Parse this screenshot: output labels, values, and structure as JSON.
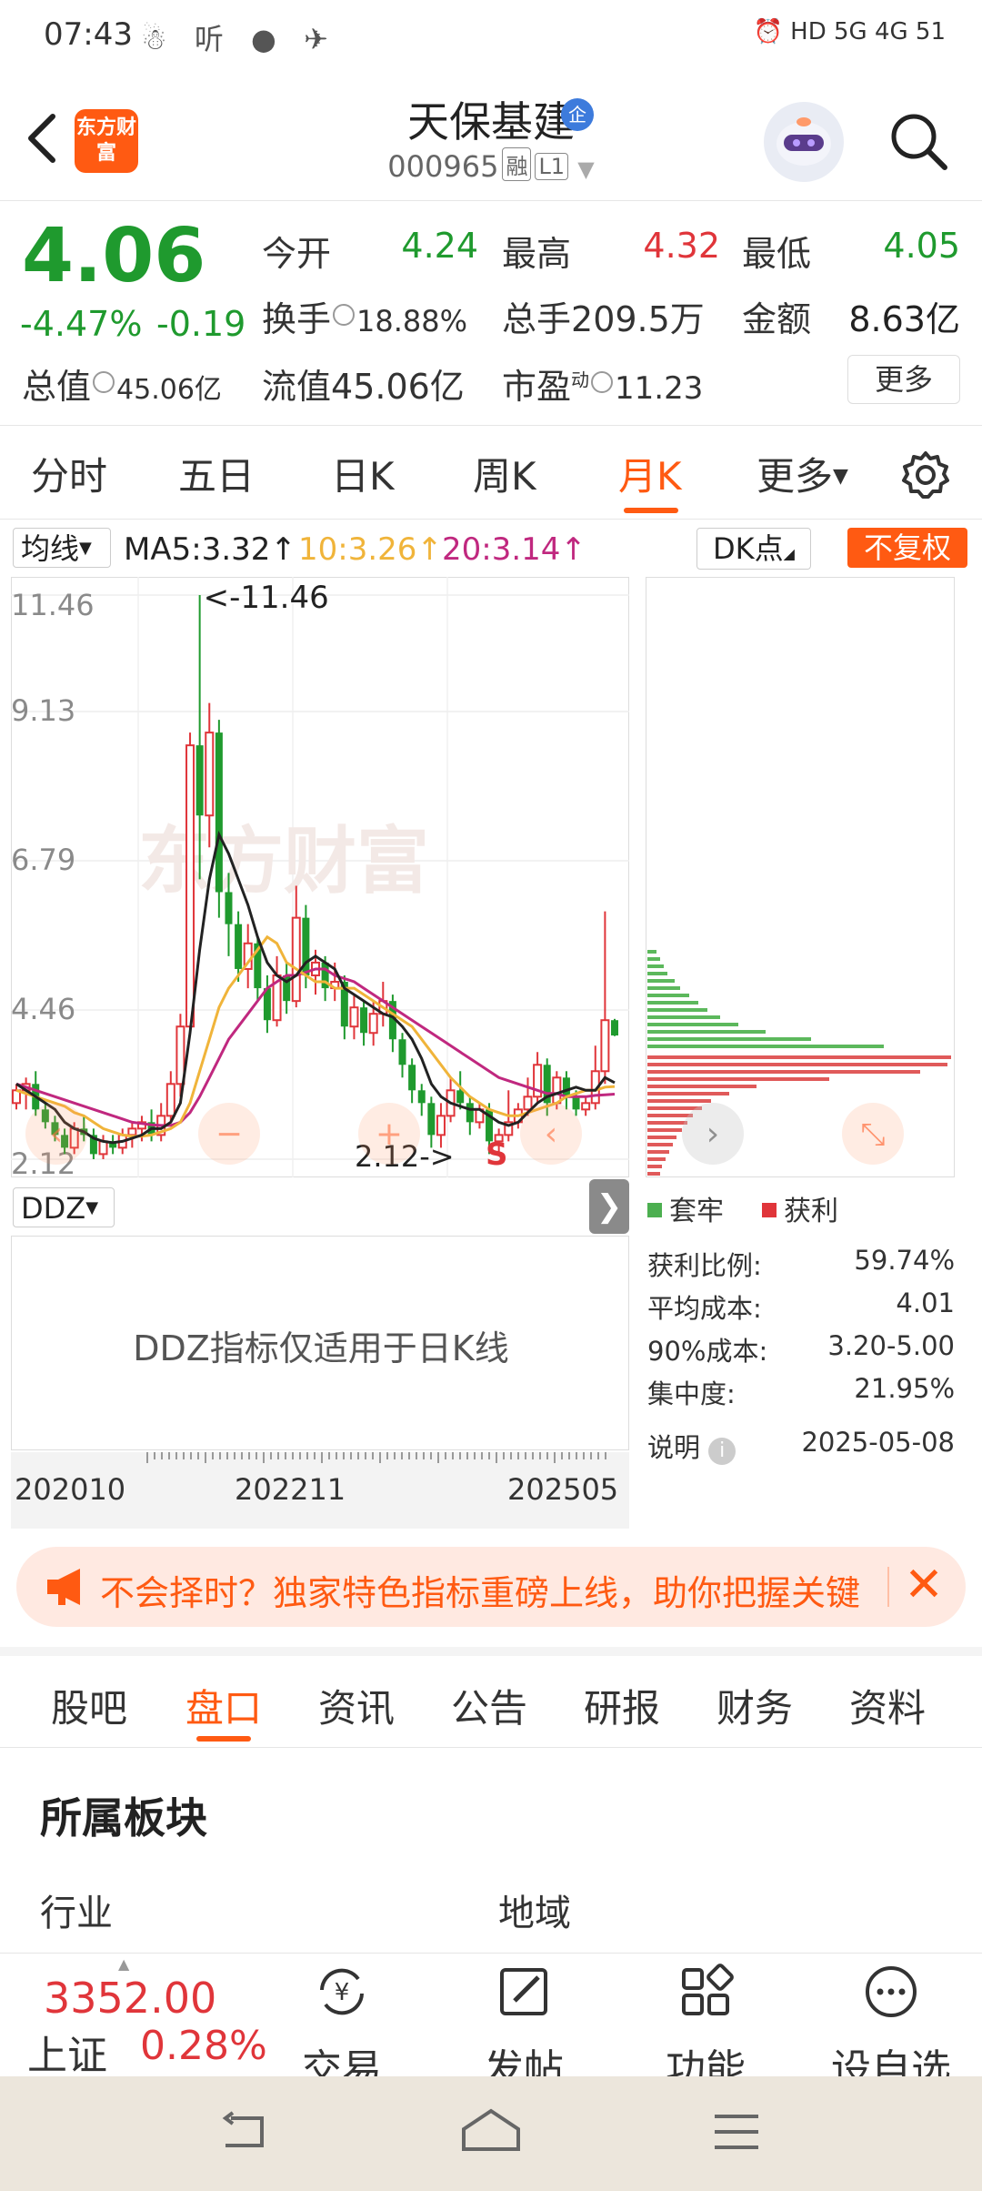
{
  "status": {
    "time": "07:43",
    "left_icons": "☃ 听 ● ✈",
    "right_icons": "⏰ HD 5G 4G 51"
  },
  "header": {
    "logo_text": "东方财富",
    "stock_name": "天保基建",
    "qi_badge": "企",
    "stock_code": "000965",
    "tag_rong": "融",
    "tag_level": "L1"
  },
  "quote": {
    "price": "4.06",
    "change_pct": "-4.47%",
    "change": "-0.19",
    "open_label": "今开",
    "open": "4.24",
    "high_label": "最高",
    "high": "4.32",
    "low_label": "最低",
    "low": "4.05",
    "turnover_label": "换手",
    "turnover": "18.88%",
    "volume_label": "总手",
    "volume": "209.5万",
    "amount_label": "金额",
    "amount": "8.63亿",
    "mcap_label": "总值",
    "mcap": "45.06亿",
    "float_label": "流值",
    "float": "45.06亿",
    "pe_label": "市盈",
    "pe_sup": "动",
    "pe": "11.23",
    "more": "更多"
  },
  "period_tabs": [
    "分时",
    "五日",
    "日K",
    "周K",
    "月K",
    "更多"
  ],
  "active_period": "月K",
  "ma": {
    "select": "均线",
    "ma5": "MA5:3.32↑",
    "ma10": "10:3.26↑",
    "ma20": "20:3.14↑",
    "dk": "DK点",
    "fuquan": "不复权"
  },
  "colors": {
    "accent": "#ff5a12",
    "up": "#e0353a",
    "down": "#1f9a2e",
    "ma5": "#222222",
    "ma10": "#f0b43a",
    "ma20": "#c0287f"
  },
  "chart_data": {
    "type": "candlestick",
    "y_ticks": [
      "11.46",
      "9.13",
      "6.79",
      "4.46",
      "2.12"
    ],
    "ylim": [
      2.12,
      11.46
    ],
    "max_annotation": "<-11.46",
    "min_annotation": "2.12->",
    "x_ticks": [
      "202010",
      "202211",
      "202505"
    ],
    "watermark": "东方财富",
    "markers": [
      "S"
    ],
    "candles": [
      [
        3.0,
        3.2,
        2.9,
        3.3
      ],
      [
        3.2,
        3.3,
        2.9,
        3.4
      ],
      [
        3.3,
        2.9,
        2.8,
        3.5
      ],
      [
        2.9,
        2.7,
        2.6,
        3.0
      ],
      [
        2.7,
        2.5,
        2.4,
        2.8
      ],
      [
        2.5,
        2.3,
        2.2,
        2.6
      ],
      [
        2.3,
        2.6,
        2.2,
        2.7
      ],
      [
        2.6,
        2.5,
        2.4,
        2.8
      ],
      [
        2.5,
        2.2,
        2.1,
        2.6
      ],
      [
        2.2,
        2.4,
        2.1,
        2.5
      ],
      [
        2.4,
        2.3,
        2.2,
        2.5
      ],
      [
        2.3,
        2.5,
        2.2,
        2.6
      ],
      [
        2.5,
        2.6,
        2.3,
        2.7
      ],
      [
        2.6,
        2.7,
        2.4,
        2.8
      ],
      [
        2.7,
        2.5,
        2.4,
        2.9
      ],
      [
        2.5,
        2.8,
        2.4,
        3.0
      ],
      [
        2.8,
        3.3,
        2.7,
        3.5
      ],
      [
        3.3,
        4.2,
        3.1,
        4.4
      ],
      [
        4.2,
        8.6,
        4.1,
        8.8
      ],
      [
        8.6,
        7.5,
        6.5,
        11.46
      ],
      [
        7.5,
        8.8,
        7.0,
        9.3
      ],
      [
        8.8,
        6.3,
        5.9,
        9.0
      ],
      [
        6.3,
        5.8,
        5.3,
        6.6
      ],
      [
        5.8,
        5.1,
        4.9,
        6.0
      ],
      [
        5.1,
        5.5,
        4.8,
        5.8
      ],
      [
        5.5,
        4.8,
        4.6,
        5.6
      ],
      [
        4.8,
        4.3,
        4.1,
        5.0
      ],
      [
        4.3,
        5.0,
        4.2,
        5.3
      ],
      [
        5.0,
        4.6,
        4.4,
        5.2
      ],
      [
        4.6,
        5.9,
        4.5,
        6.4
      ],
      [
        5.9,
        5.0,
        4.8,
        6.1
      ],
      [
        5.0,
        5.2,
        4.7,
        5.4
      ],
      [
        5.2,
        4.8,
        4.6,
        5.3
      ],
      [
        4.8,
        4.9,
        4.6,
        5.2
      ],
      [
        4.9,
        4.2,
        4.0,
        5.0
      ],
      [
        4.2,
        4.5,
        4.0,
        4.7
      ],
      [
        4.5,
        4.1,
        3.9,
        4.6
      ],
      [
        4.1,
        4.4,
        3.9,
        4.6
      ],
      [
        4.4,
        4.6,
        4.2,
        4.9
      ],
      [
        4.6,
        4.0,
        3.8,
        4.7
      ],
      [
        4.0,
        3.6,
        3.4,
        4.1
      ],
      [
        3.6,
        3.2,
        3.0,
        3.7
      ],
      [
        3.2,
        3.0,
        2.8,
        3.3
      ],
      [
        3.0,
        2.5,
        2.3,
        3.1
      ],
      [
        2.5,
        2.8,
        2.3,
        3.0
      ],
      [
        2.8,
        3.2,
        2.7,
        3.4
      ],
      [
        3.2,
        3.0,
        2.9,
        3.5
      ],
      [
        3.0,
        2.7,
        2.5,
        3.1
      ],
      [
        2.7,
        2.9,
        2.6,
        3.0
      ],
      [
        2.9,
        2.4,
        2.2,
        3.0
      ],
      [
        2.4,
        2.5,
        2.2,
        2.6
      ],
      [
        2.5,
        2.7,
        2.4,
        3.2
      ],
      [
        2.7,
        2.9,
        2.6,
        3.0
      ],
      [
        2.9,
        3.1,
        2.8,
        3.4
      ],
      [
        3.1,
        3.6,
        3.0,
        3.8
      ],
      [
        3.6,
        3.0,
        2.8,
        3.7
      ],
      [
        3.0,
        3.4,
        2.9,
        3.5
      ],
      [
        3.4,
        3.1,
        2.9,
        3.5
      ],
      [
        3.1,
        2.9,
        2.8,
        3.2
      ],
      [
        2.9,
        3.0,
        2.8,
        3.1
      ],
      [
        3.0,
        3.5,
        2.9,
        3.9
      ],
      [
        3.5,
        4.3,
        3.3,
        6.0
      ],
      [
        4.3,
        4.06,
        4.05,
        4.32
      ]
    ],
    "ma5": [
      3.3,
      3.2,
      3.1,
      3.0,
      2.9,
      2.7,
      2.6,
      2.55,
      2.45,
      2.4,
      2.38,
      2.4,
      2.45,
      2.5,
      2.6,
      2.6,
      2.7,
      3.0,
      4.1,
      5.4,
      6.5,
      7.2,
      6.9,
      6.5,
      6.1,
      5.6,
      5.2,
      5.0,
      4.9,
      5.0,
      5.2,
      5.3,
      5.2,
      5.1,
      4.8,
      4.7,
      4.6,
      4.5,
      4.4,
      4.35,
      4.2,
      4.0,
      3.7,
      3.3,
      3.1,
      3.0,
      2.95,
      2.9,
      2.9,
      2.8,
      2.7,
      2.65,
      2.7,
      2.85,
      3.0,
      3.1,
      3.15,
      3.2,
      3.25,
      3.2,
      3.2,
      3.4,
      3.32
    ],
    "ma10": [
      3.2,
      3.15,
      3.1,
      3.05,
      3.0,
      2.95,
      2.85,
      2.8,
      2.7,
      2.6,
      2.55,
      2.5,
      2.48,
      2.48,
      2.5,
      2.55,
      2.6,
      2.7,
      3.0,
      3.5,
      4.0,
      4.5,
      4.8,
      5.0,
      5.2,
      5.4,
      5.6,
      5.5,
      5.2,
      5.1,
      5.0,
      4.9,
      4.9,
      4.8,
      4.8,
      4.8,
      4.7,
      4.6,
      4.5,
      4.4,
      4.3,
      4.2,
      4.0,
      3.8,
      3.6,
      3.4,
      3.25,
      3.1,
      3.0,
      2.9,
      2.85,
      2.8,
      2.8,
      2.85,
      2.9,
      2.95,
      3.0,
      3.1,
      3.15,
      3.2,
      3.2,
      3.25,
      3.26
    ],
    "ma20": [
      3.3,
      3.25,
      3.2,
      3.15,
      3.1,
      3.05,
      3.0,
      2.95,
      2.9,
      2.85,
      2.8,
      2.75,
      2.7,
      2.68,
      2.66,
      2.65,
      2.65,
      2.7,
      2.85,
      3.1,
      3.4,
      3.7,
      4.0,
      4.2,
      4.4,
      4.6,
      4.8,
      4.9,
      5.0,
      5.0,
      5.05,
      5.1,
      5.1,
      5.0,
      4.95,
      4.9,
      4.8,
      4.7,
      4.6,
      4.5,
      4.4,
      4.3,
      4.2,
      4.1,
      4.0,
      3.9,
      3.8,
      3.7,
      3.6,
      3.5,
      3.4,
      3.35,
      3.3,
      3.25,
      3.2,
      3.15,
      3.15,
      3.1,
      3.1,
      3.1,
      3.12,
      3.13,
      3.14
    ]
  },
  "chip": {
    "legend_trapped": "套牢",
    "legend_profit": "获利",
    "profit_ratio_label": "获利比例:",
    "profit_ratio": "59.74%",
    "avg_cost_label": "平均成本:",
    "avg_cost": "4.01",
    "cost90_label": "90%成本:",
    "cost90": "3.20-5.00",
    "concentration_label": "集中度:",
    "concentration": "21.95%",
    "note_label": "说明",
    "date": "2025-05-08"
  },
  "ddz": {
    "select": "DDZ",
    "message": "DDZ指标仅适用于日K线"
  },
  "promo": {
    "text": "不会择时？独家特色指标重磅上线，助你把握关键"
  },
  "section_tabs": [
    "股吧",
    "盘口",
    "资讯",
    "公告",
    "研报",
    "财务",
    "资料"
  ],
  "active_section": "盘口",
  "sector": {
    "title": "所属板块",
    "industry_label": "行业",
    "region_label": "地域"
  },
  "bottom": {
    "index_value": "3352.00",
    "index_name": "上证",
    "index_pct": "0.28%",
    "items": [
      "交易",
      "发帖",
      "功能",
      "设自选"
    ]
  }
}
